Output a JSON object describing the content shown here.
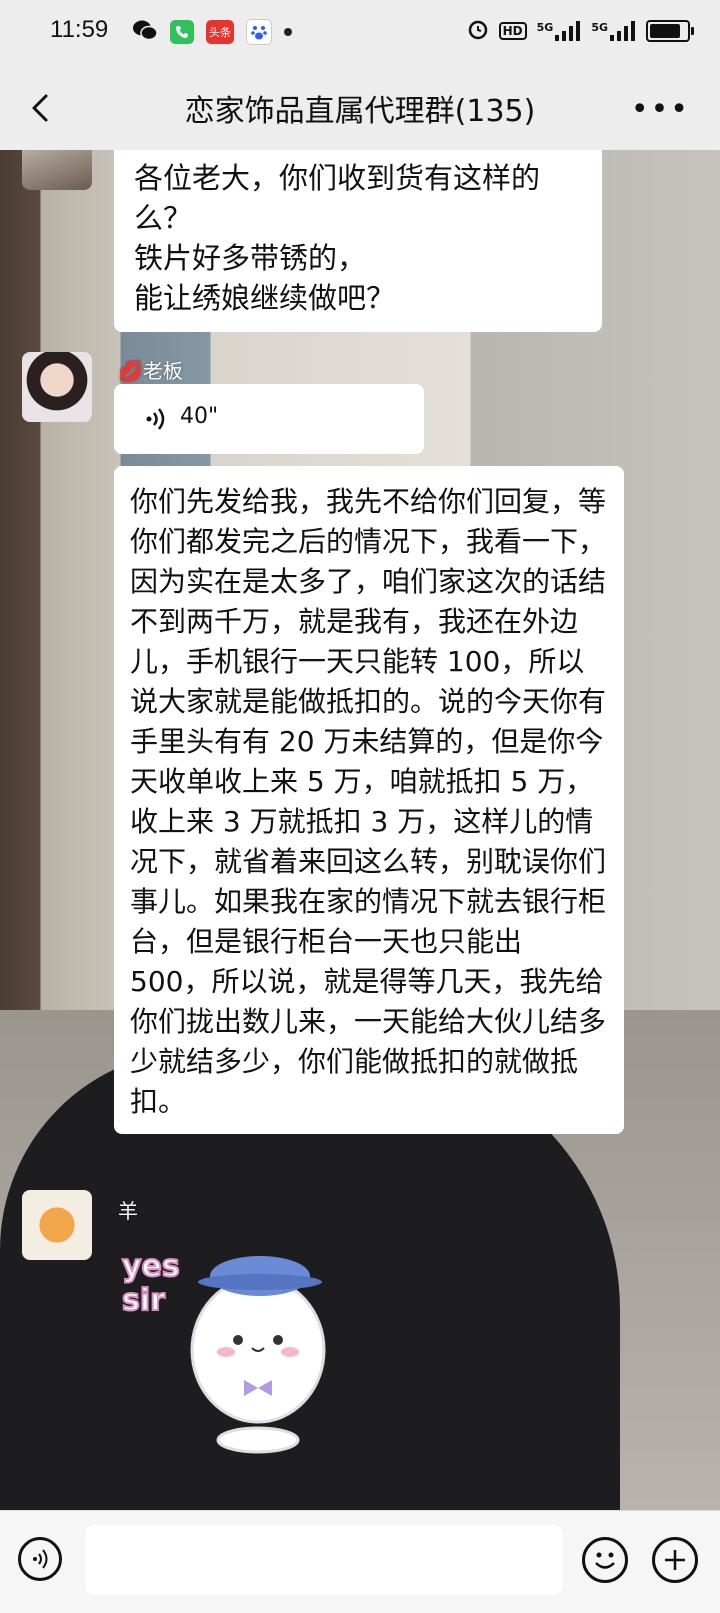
{
  "status_bar": {
    "time": "11:59",
    "left_icons": [
      "wechat-icon",
      "phone-icon",
      "toutiao-icon",
      "baidu-icon"
    ],
    "toutiao_label": "头条",
    "right_icons": [
      "alarm-icon",
      "hd-icon",
      "signal-5g-icon",
      "signal-5g-icon",
      "battery-icon"
    ],
    "hd_label": "HD",
    "net1": "5G",
    "net2": "5G"
  },
  "header": {
    "title": "恋家饰品直属代理群(135)"
  },
  "messages": [
    {
      "type": "text",
      "text": "各位老大，你们收到货有这样的么？\n铁片好多带锈的，\n能让绣娘继续做吧？"
    },
    {
      "type": "voice",
      "sender": "💋老板",
      "duration": "40\""
    },
    {
      "type": "text",
      "text": "你们先发给我，我先不给你们回复，等你们都发完之后的情况下，我看一下，因为实在是太多了，咱们家这次的话结不到两千万，就是我有，我还在外边儿，手机银行一天只能转 100，所以说大家就是能做抵扣的。说的今天你有手里头有有 20 万未结算的，但是你今天收单收上来 5 万，咱就抵扣 5 万，收上来 3 万就抵扣 3 万，这样儿的情况下，就省着来回这么转，别耽误你们事儿。如果我在家的情况下就去银行柜台，但是银行柜台一天也只能出 500，所以说，就是得等几天，我先给你们拢出数儿来，一天能给大伙儿结多少就结多少，你们能做抵扣的就做抵扣。"
    },
    {
      "type": "sticker",
      "sender": "羊",
      "sticker_text": "yes\nsir"
    }
  ],
  "colors": {
    "bar_bg": "#ededed",
    "bubble_bg": "#ffffff"
  }
}
